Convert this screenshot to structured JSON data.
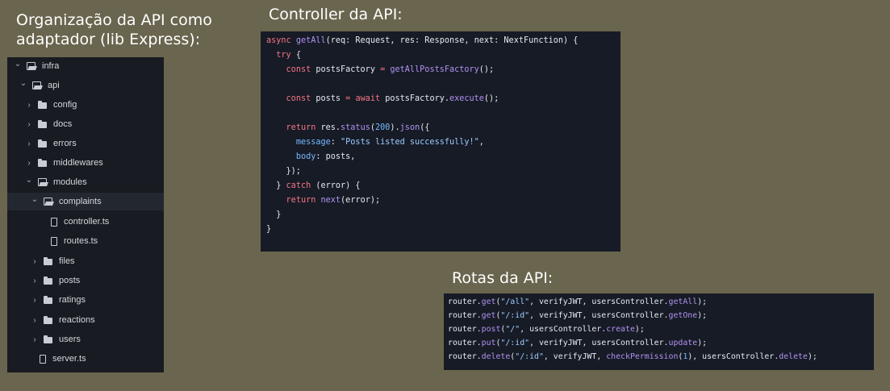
{
  "headings": {
    "organizacao": "Organização da API como\nadaptador (lib Express):",
    "controller": "Controller da API:",
    "rotas": "Rotas da API:"
  },
  "file_tree": [
    {
      "label": "infra",
      "type": "folder",
      "expanded": true,
      "depth": 0,
      "icon": "folder-open-icon"
    },
    {
      "label": "api",
      "type": "folder",
      "expanded": true,
      "depth": 1,
      "icon": "folder-open-icon"
    },
    {
      "label": "config",
      "type": "folder",
      "expanded": false,
      "depth": 2,
      "icon": "folder-icon"
    },
    {
      "label": "docs",
      "type": "folder",
      "expanded": false,
      "depth": 2,
      "icon": "folder-icon"
    },
    {
      "label": "errors",
      "type": "folder",
      "expanded": false,
      "depth": 2,
      "icon": "folder-icon"
    },
    {
      "label": "middlewares",
      "type": "folder",
      "expanded": false,
      "depth": 2,
      "icon": "folder-icon"
    },
    {
      "label": "modules",
      "type": "folder",
      "expanded": true,
      "depth": 2,
      "icon": "folder-open-icon"
    },
    {
      "label": "complaints",
      "type": "folder",
      "expanded": true,
      "depth": 3,
      "icon": "folder-open-icon",
      "selected": true
    },
    {
      "label": "controller.ts",
      "type": "file",
      "depth": 4,
      "icon": "file-icon"
    },
    {
      "label": "routes.ts",
      "type": "file",
      "depth": 4,
      "icon": "file-icon"
    },
    {
      "label": "files",
      "type": "folder",
      "expanded": false,
      "depth": 3,
      "icon": "folder-icon"
    },
    {
      "label": "posts",
      "type": "folder",
      "expanded": false,
      "depth": 3,
      "icon": "folder-icon"
    },
    {
      "label": "ratings",
      "type": "folder",
      "expanded": false,
      "depth": 3,
      "icon": "folder-icon"
    },
    {
      "label": "reactions",
      "type": "folder",
      "expanded": false,
      "depth": 3,
      "icon": "folder-icon"
    },
    {
      "label": "users",
      "type": "folder",
      "expanded": false,
      "depth": 3,
      "icon": "folder-icon"
    },
    {
      "label": "server.ts",
      "type": "file",
      "depth": 2,
      "icon": "file-icon"
    }
  ],
  "controller_code": [
    [
      [
        "kw",
        "async "
      ],
      [
        "fn",
        "getAll"
      ],
      [
        "",
        "(req: Request, res: Response, next: NextFunction) {"
      ]
    ],
    [
      [
        "",
        "  "
      ],
      [
        "kw",
        "try"
      ],
      [
        "",
        " {"
      ]
    ],
    [
      [
        "",
        "    "
      ],
      [
        "kw",
        "const"
      ],
      [
        "",
        " postsFactory "
      ],
      [
        "kw",
        "="
      ],
      [
        "",
        " "
      ],
      [
        "fn",
        "getAllPostsFactory"
      ],
      [
        "",
        "();"
      ]
    ],
    [
      [
        "",
        ""
      ]
    ],
    [
      [
        "",
        "    "
      ],
      [
        "kw",
        "const"
      ],
      [
        "",
        " posts "
      ],
      [
        "kw",
        "="
      ],
      [
        "",
        " "
      ],
      [
        "kw",
        "await"
      ],
      [
        "",
        " postsFactory."
      ],
      [
        "fn",
        "execute"
      ],
      [
        "",
        "();"
      ]
    ],
    [
      [
        "",
        ""
      ]
    ],
    [
      [
        "",
        "    "
      ],
      [
        "kw",
        "return"
      ],
      [
        "",
        " res."
      ],
      [
        "fn",
        "status"
      ],
      [
        "",
        "("
      ],
      [
        "num",
        "200"
      ],
      [
        "",
        ")."
      ],
      [
        "fn",
        "json"
      ],
      [
        "",
        "({"
      ]
    ],
    [
      [
        "",
        "      "
      ],
      [
        "prop",
        "message"
      ],
      [
        "",
        ": "
      ],
      [
        "str",
        "\"Posts listed successfully!\""
      ],
      [
        "",
        ","
      ]
    ],
    [
      [
        "",
        "      "
      ],
      [
        "prop",
        "body"
      ],
      [
        "",
        ": posts,"
      ]
    ],
    [
      [
        "",
        "    });"
      ]
    ],
    [
      [
        "",
        "  } "
      ],
      [
        "kw",
        "catch"
      ],
      [
        "",
        " (error) {"
      ]
    ],
    [
      [
        "",
        "    "
      ],
      [
        "kw",
        "return"
      ],
      [
        "",
        " "
      ],
      [
        "fn",
        "next"
      ],
      [
        "",
        "(error);"
      ]
    ],
    [
      [
        "",
        "  }"
      ]
    ],
    [
      [
        "",
        "}"
      ]
    ]
  ],
  "routes_code": [
    [
      [
        "",
        "router."
      ],
      [
        "fn",
        "get"
      ],
      [
        "",
        "("
      ],
      [
        "str",
        "\"/all\""
      ],
      [
        "",
        ", verifyJWT, usersController."
      ],
      [
        "fn",
        "getAll"
      ],
      [
        "",
        ");"
      ]
    ],
    [
      [
        "",
        "router."
      ],
      [
        "fn",
        "get"
      ],
      [
        "",
        "("
      ],
      [
        "str",
        "\"/:id\""
      ],
      [
        "",
        ", verifyJWT, usersController."
      ],
      [
        "fn",
        "getOne"
      ],
      [
        "",
        ");"
      ]
    ],
    [
      [
        "",
        "router."
      ],
      [
        "fn",
        "post"
      ],
      [
        "",
        "("
      ],
      [
        "str",
        "\"/\""
      ],
      [
        "",
        ", usersController."
      ],
      [
        "fn",
        "create"
      ],
      [
        "",
        ");"
      ]
    ],
    [
      [
        "",
        "router."
      ],
      [
        "fn",
        "put"
      ],
      [
        "",
        "("
      ],
      [
        "str",
        "\"/:id\""
      ],
      [
        "",
        ", verifyJWT, usersController."
      ],
      [
        "fn",
        "update"
      ],
      [
        "",
        ");"
      ]
    ],
    [
      [
        "",
        "router."
      ],
      [
        "fn",
        "delete"
      ],
      [
        "",
        "("
      ],
      [
        "str",
        "\"/:id\""
      ],
      [
        "",
        ", verifyJWT, "
      ],
      [
        "fn",
        "checkPermission"
      ],
      [
        "",
        "("
      ],
      [
        "num",
        "1"
      ],
      [
        "",
        "), usersController."
      ],
      [
        "fn",
        "delete"
      ],
      [
        "",
        ");"
      ]
    ]
  ]
}
